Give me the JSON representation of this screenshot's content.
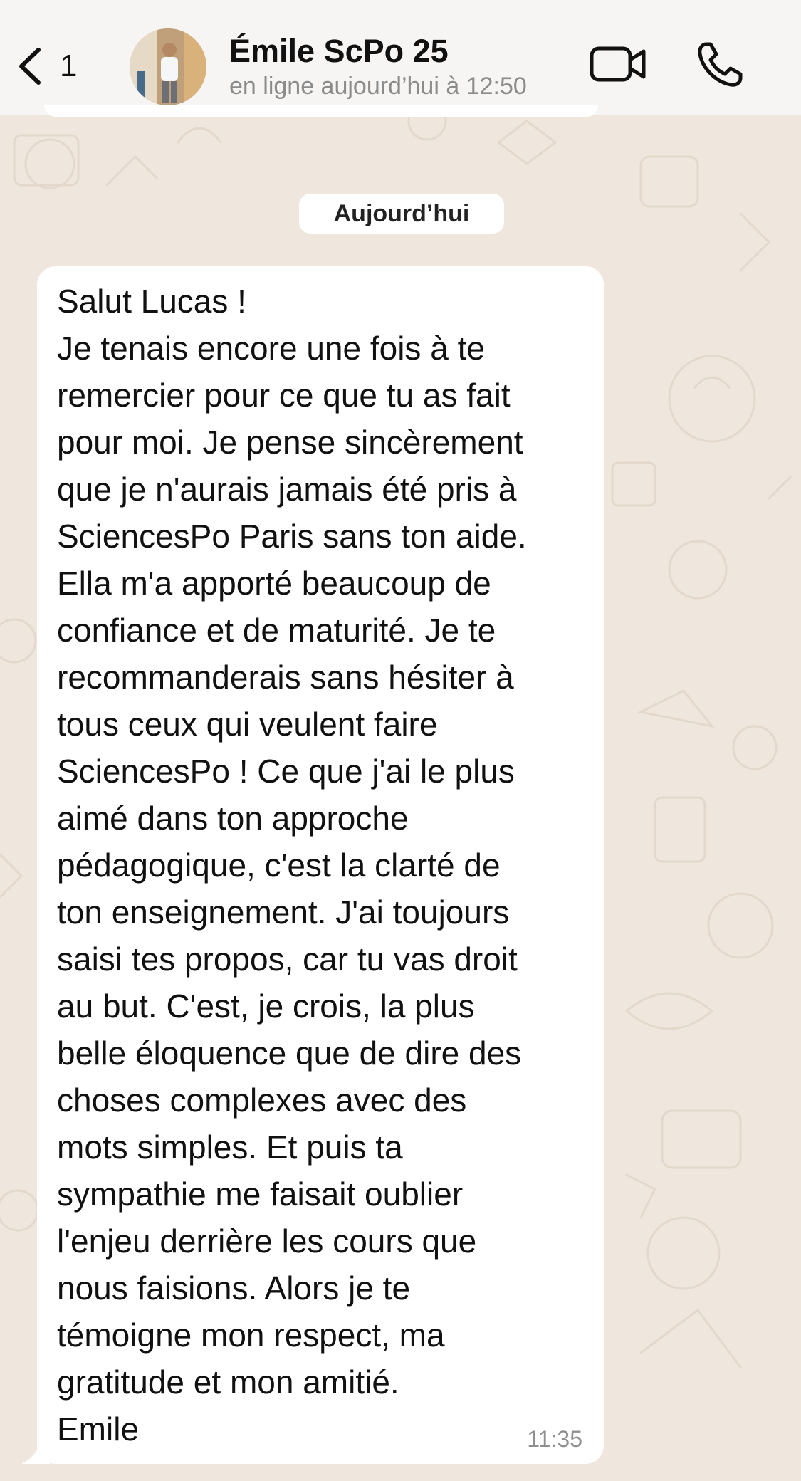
{
  "header": {
    "back_count": "1",
    "title": "Émile ScPo 25",
    "subtitle": "en ligne aujourd’hui à 12:50"
  },
  "date_separator": "Aujourd’hui",
  "message": {
    "lines": [
      "Salut Lucas !",
      "Je tenais encore une fois à te",
      "remercier pour ce que tu as fait",
      "pour moi. Je pense sincèrement",
      "que je n'aurais jamais été pris à",
      "SciencesPo Paris sans ton aide.",
      "Ella m'a apporté beaucoup de",
      "confiance et de maturité. Je te",
      "recommanderais sans hésiter à",
      "tous ceux qui veulent faire",
      "SciencesPo ! Ce que j'ai le plus",
      "aimé dans ton approche",
      "pédagogique, c'est la clarté de",
      "ton enseignement. J'ai toujours",
      "saisi tes propos, car tu vas droit",
      "au but. C'est, je crois, la plus",
      "belle éloquence que de dire des",
      "choses complexes avec des",
      "mots simples. Et puis ta",
      "sympathie me faisait oublier",
      "l'enjeu derrière les cours que",
      "nous faisions. Alors je te",
      "témoigne mon respect, ma",
      "gratitude et mon amitié.",
      "Emile"
    ],
    "time": "11:35"
  },
  "icons": {
    "back": "chevron-left-icon",
    "video": "video-camera-icon",
    "call": "phone-icon"
  },
  "colors": {
    "chat_background": "#efe7de",
    "header_background": "#f6f5f3",
    "bubble": "#ffffff",
    "text": "#111111",
    "secondary_text": "#8b8b8b"
  }
}
